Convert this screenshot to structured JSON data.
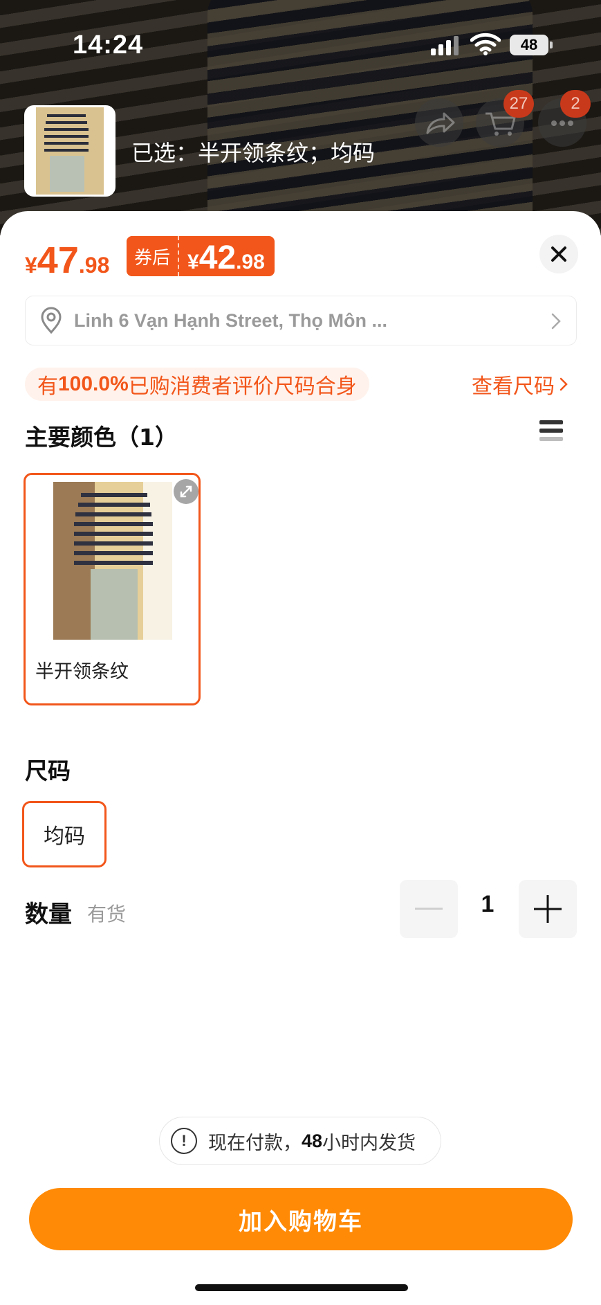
{
  "status_bar": {
    "time": "14:24",
    "battery": "48"
  },
  "header": {
    "selected_label": "已选：半开领条纹；均码",
    "cart_badge": "27",
    "more_badge": "2",
    "icons": [
      "share-icon",
      "cart-icon",
      "more-icon"
    ]
  },
  "price": {
    "currency": "¥",
    "main_int": "47",
    "main_dec": ".98",
    "coupon_tag": "券后",
    "coupon_int": "42",
    "coupon_dec": ".98"
  },
  "address": {
    "text": "Linh 6 Vạn Hạnh Street, Thọ Môn ..."
  },
  "fit": {
    "prefix": "有",
    "rate": "100.0%",
    "suffix": "已购消费者评价尺码合身",
    "size_chart_link": "查看尺码"
  },
  "color_section": {
    "title": "主要颜色（1）",
    "options": [
      {
        "name": "半开领条纹",
        "selected": true
      }
    ]
  },
  "size_section": {
    "title": "尺码",
    "options": [
      {
        "name": "均码",
        "selected": true
      }
    ]
  },
  "quantity": {
    "title": "数量",
    "stock": "有货",
    "value": "1"
  },
  "shipping": {
    "prefix": "现在付款，",
    "hours": "48",
    "suffix": "小时内发货"
  },
  "cart_button": {
    "label": "加入购物车"
  },
  "colors": {
    "accent": "#f2561a",
    "button": "#ff8a05"
  }
}
